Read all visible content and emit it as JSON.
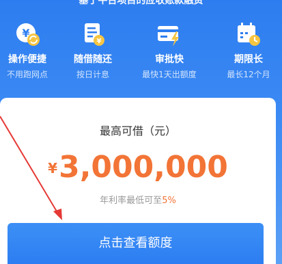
{
  "header": {
    "top_text": "基于平台项目的应收账款融资"
  },
  "features": [
    {
      "title": "操作便捷",
      "subtitle": "不用跑网点",
      "icon": "yen-refresh-icon"
    },
    {
      "title": "随借随还",
      "subtitle": "按日计息",
      "icon": "document-yen-icon"
    },
    {
      "title": "审批快",
      "subtitle": "最快1天出额度",
      "icon": "card-lightning-icon"
    },
    {
      "title": "期限长",
      "subtitle": "最长12个月",
      "icon": "calendar-clock-icon"
    }
  ],
  "card": {
    "label": "最高可借（元）",
    "currency": "¥",
    "amount": "3,000,000",
    "rate_prefix": "年利率最低可至",
    "rate_value": "5%"
  },
  "cta": {
    "label": "点击查看额度"
  },
  "colors": {
    "primary_blue": "#2d7df0",
    "accent_orange": "#f27436",
    "icon_yellow": "#f5c542",
    "annotation_red": "#e53935"
  }
}
